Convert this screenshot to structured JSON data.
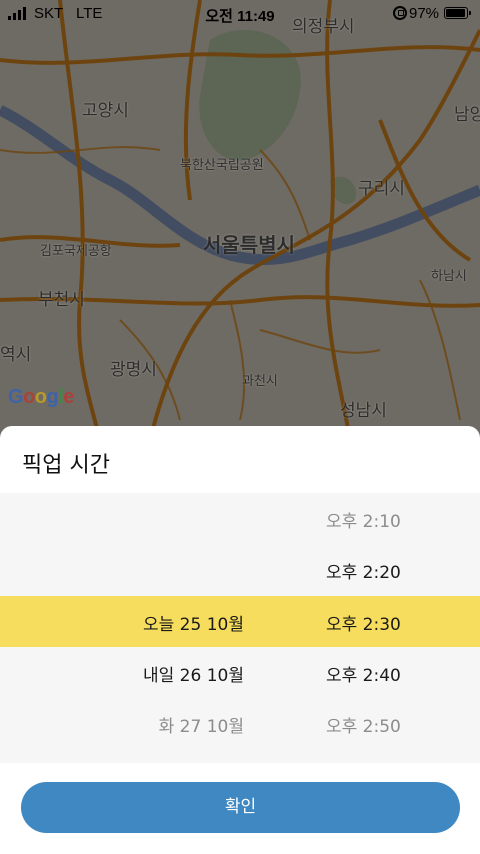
{
  "status_bar": {
    "carrier": "SKT",
    "network": "LTE",
    "time": "오전 11:49",
    "battery_percent": "97%",
    "battery_level": 0.97
  },
  "map": {
    "labels": [
      "의정부시",
      "고양시",
      "남양",
      "북한산국립공원",
      "구리시",
      "김포국제공항",
      "서울특별시",
      "하남시",
      "부천시",
      "역시",
      "광명시",
      "과천시",
      "성남시"
    ],
    "attribution": "Google",
    "colors": {
      "road": "#c77d1c",
      "river": "#7a8db1",
      "land": "#c9c4b6"
    }
  },
  "sheet": {
    "title": "픽업 시간",
    "rows": [
      {
        "date": "",
        "time": "오후 2:10"
      },
      {
        "date": "",
        "time": "오후 2:20"
      },
      {
        "date": "오늘 25 10월",
        "time": "오후 2:30"
      },
      {
        "date": "내일 26 10월",
        "time": "오후 2:40"
      },
      {
        "date": "화 27 10월",
        "time": "오후 2:50"
      }
    ],
    "highlight_color": "#f7dd5d",
    "confirm_label": "확인",
    "confirm_color": "#3f88c2"
  }
}
